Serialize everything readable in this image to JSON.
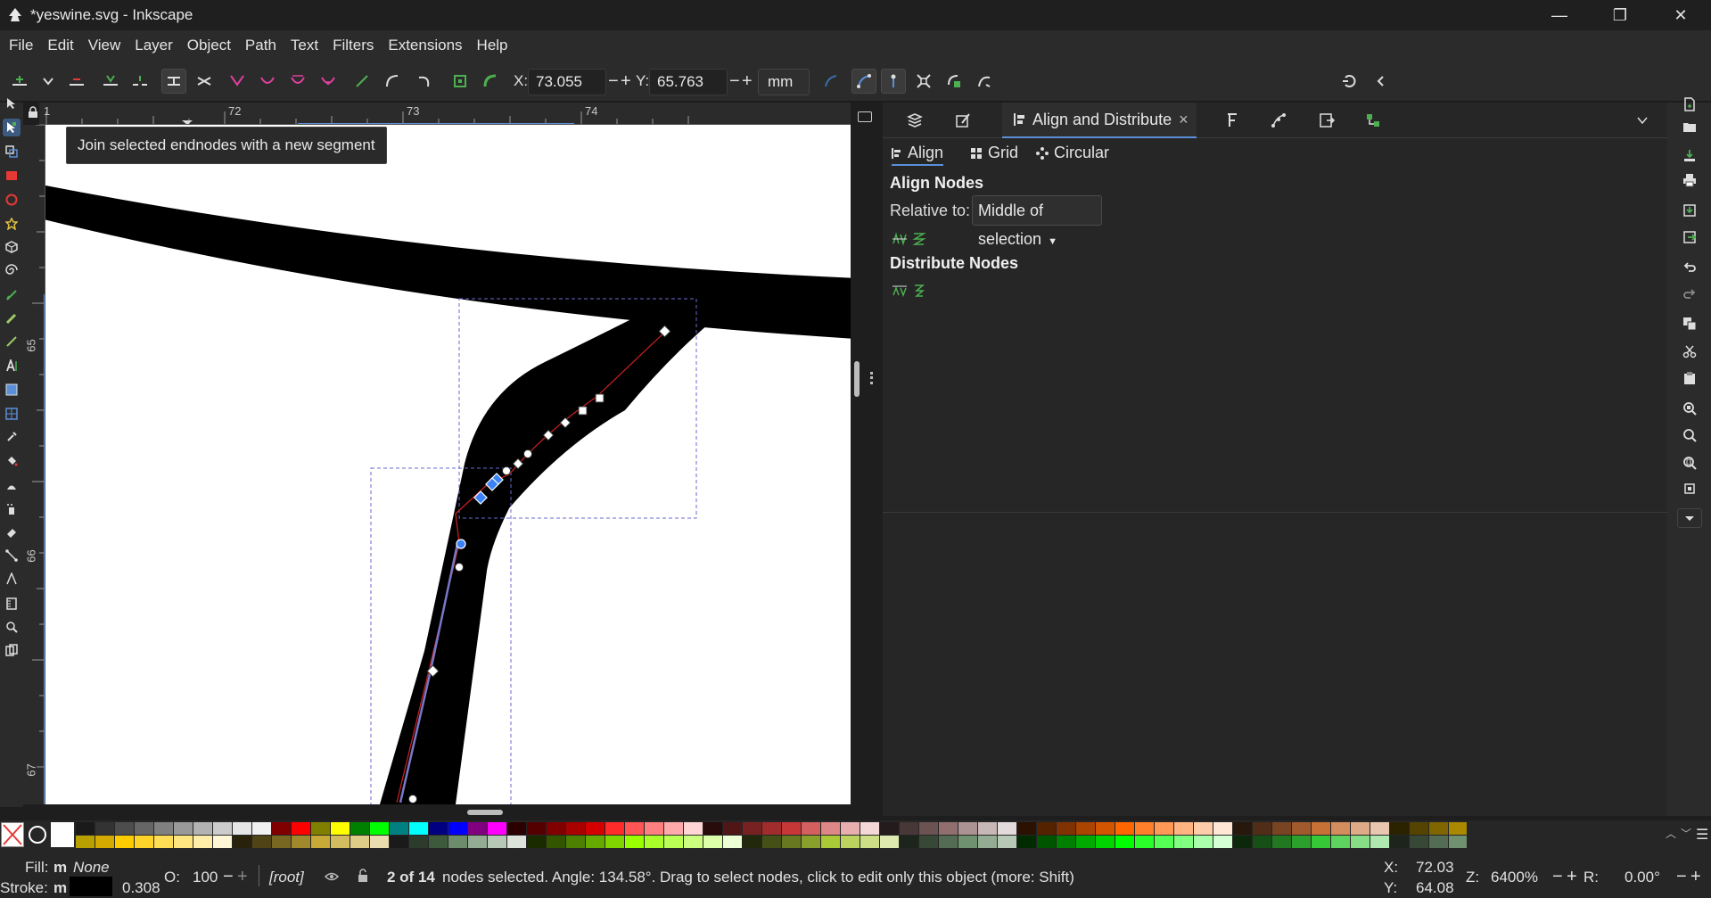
{
  "window": {
    "title": "*yeswine.svg - Inkscape",
    "minimize": "—",
    "maximize": "❐",
    "close": "✕"
  },
  "menu": [
    "File",
    "Edit",
    "View",
    "Layer",
    "Object",
    "Path",
    "Text",
    "Filters",
    "Extensions",
    "Help"
  ],
  "toolbar": {
    "x_label": "X:",
    "x_value": "73.055",
    "y_label": "Y:",
    "y_value": "65.763",
    "unit": "mm",
    "minus": "−",
    "plus": "+"
  },
  "ruler": {
    "top_labels": [
      "1",
      "72",
      "73",
      "74"
    ],
    "left_labels": [
      "65",
      "66",
      "67"
    ]
  },
  "tooltip": "Join selected endnodes with a new segment",
  "dock": {
    "active_tab": "Align and Distribute",
    "tab_close": "×",
    "subtabs": [
      "Align",
      "Grid",
      "Circular"
    ],
    "align_nodes_heading": "Align Nodes",
    "relative_label": "Relative to:",
    "relative_value": "Middle of selection",
    "distribute_nodes_heading": "Distribute Nodes"
  },
  "status": {
    "fill_label": "Fill:",
    "fill_m": "m",
    "fill_value": "None",
    "stroke_label": "Stroke:",
    "stroke_m": "m",
    "stroke_width": "0.308",
    "opacity_label": "O:",
    "opacity_value": "100",
    "layer": "[root]",
    "message_bold": "2 of 14",
    "message": " nodes selected. Angle: 134.58°. Drag to select nodes, click to edit only this object (more: Shift)",
    "x_label": "X:",
    "x_value": "72.03",
    "y_label": "Y:",
    "y_value": "64.08",
    "zoom_label": "Z:",
    "zoom_value": "6400%",
    "rotate_label": "R:",
    "rotate_value": "0.00°"
  },
  "colors": {
    "accent": "#5b8fd8",
    "node_selected": "#3b82f6",
    "path_stroke": "#000000"
  }
}
